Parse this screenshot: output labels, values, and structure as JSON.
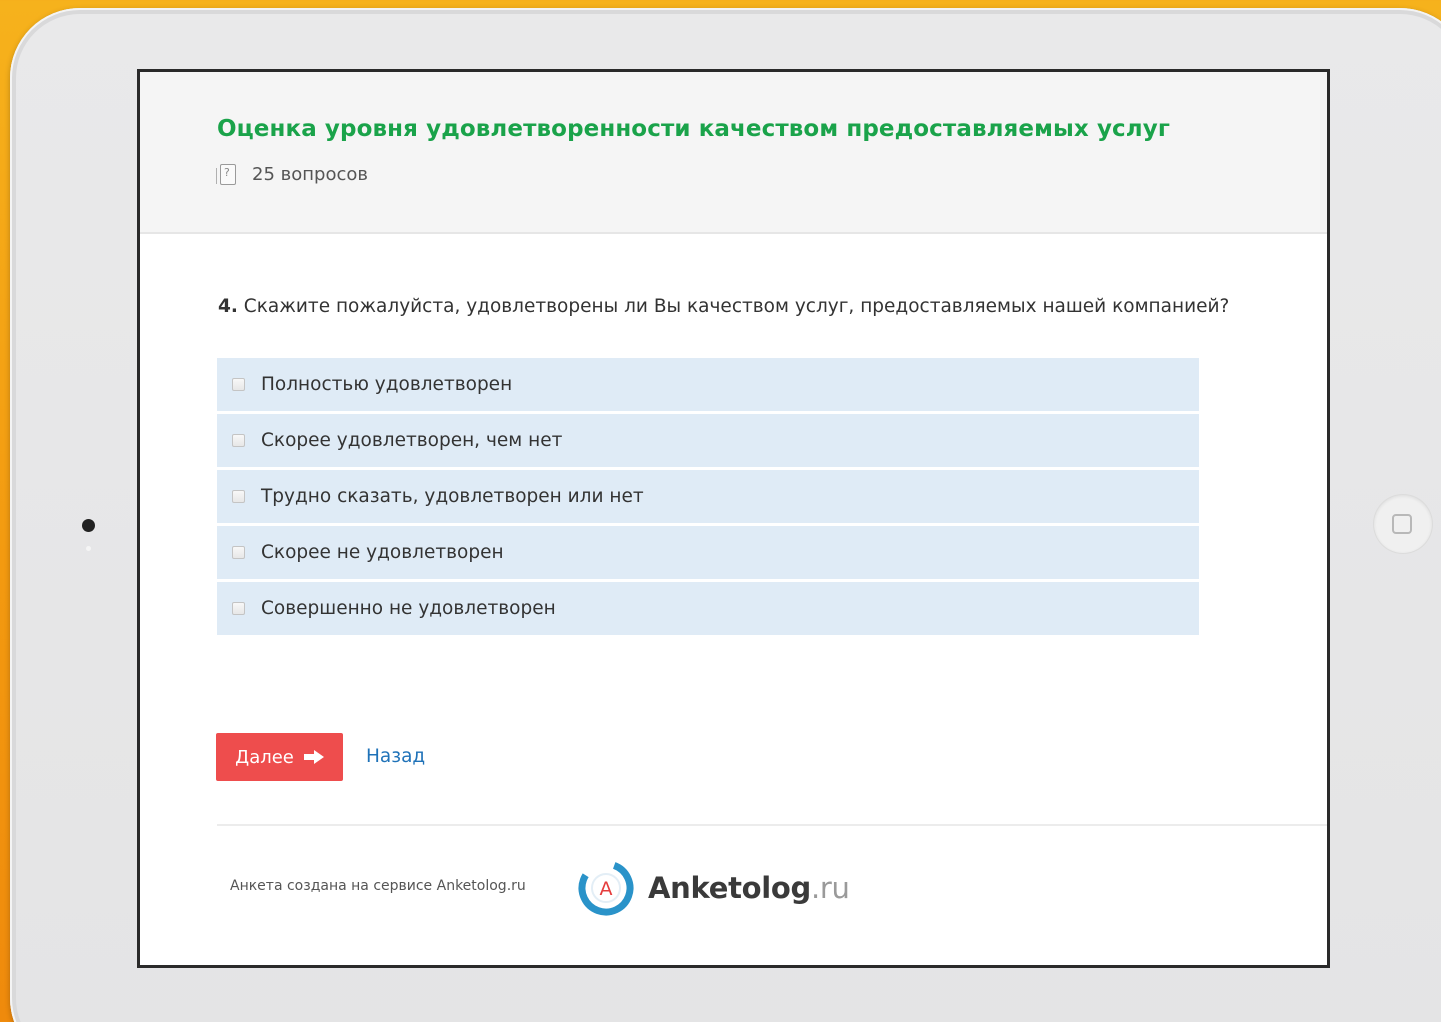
{
  "survey": {
    "title": "Оценка уровня удовлетворенности качеством предоставляемых услуг",
    "question_count": "25 вопросов"
  },
  "question": {
    "number": "4.",
    "text": "Скажите пожалуйста, удовлетворены ли Вы качеством услуг, предоставляемых нашей компанией?",
    "options": [
      {
        "label": "Полностью удовлетворен"
      },
      {
        "label": "Скорее удовлетворен, чем нет"
      },
      {
        "label": "Трудно сказать, удовлетворен или нет"
      },
      {
        "label": "Скорее не удовлетворен"
      },
      {
        "label": "Совершенно не удовлетворен"
      }
    ]
  },
  "navigation": {
    "next_label": "Далее",
    "back_label": "Назад"
  },
  "footer": {
    "credit": "Анкета создана на сервисе Anketolog.ru",
    "logo_name": "Anketolog",
    "logo_tld": ".ru",
    "logo_letter": "A"
  },
  "colors": {
    "title_green": "#1aa34a",
    "next_button_red": "#ee4d4d",
    "link_blue": "#1f72b8",
    "option_bg": "#dfebf6",
    "background_orange": "#f5a316"
  },
  "icons": {
    "question_count": "question-document-icon",
    "next": "arrow-right-icon",
    "logo": "anketolog-logo-icon"
  }
}
